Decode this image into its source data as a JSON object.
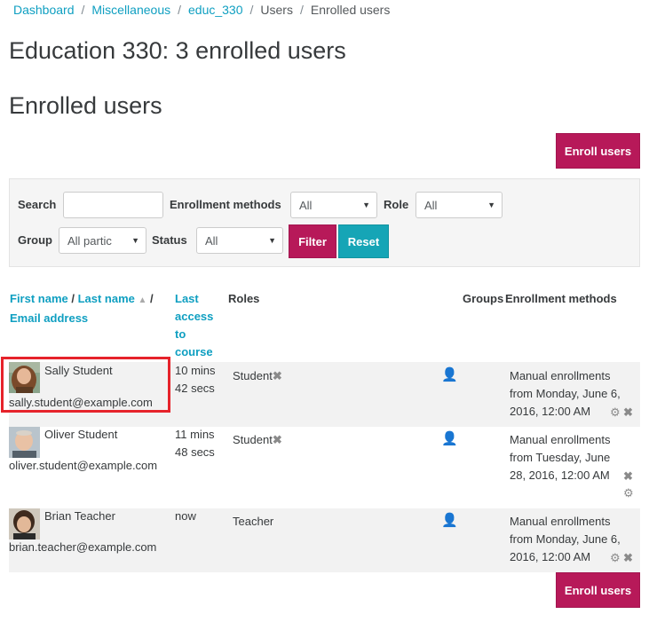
{
  "breadcrumb": {
    "items": [
      "Dashboard",
      "Miscellaneous",
      "educ_330",
      "Users",
      "Enrolled users"
    ],
    "separator": "/"
  },
  "page_title": "Education 330: 3 enrolled users",
  "section_title": "Enrolled users",
  "enroll_button_label": "Enroll users",
  "filters": {
    "search_label": "Search",
    "search_value": "",
    "enrollment_methods_label": "Enrollment methods",
    "enrollment_methods_value": "All",
    "role_label": "Role",
    "role_value": "All",
    "group_label": "Group",
    "group_value": "All partic",
    "status_label": "Status",
    "status_value": "All",
    "filter_button": "Filter",
    "reset_button": "Reset"
  },
  "table": {
    "headers": {
      "first_name": "First name",
      "name_sep": " / ",
      "last_name": "Last name",
      "sort_sep": " /",
      "email": "Email address",
      "last_access": [
        "Last",
        "access",
        "to",
        "course"
      ],
      "roles": "Roles",
      "groups": "Groups",
      "enrollment_methods": "Enrollment methods"
    },
    "rows": [
      {
        "name": "Sally Student",
        "email": "sally.student@example.com",
        "last_access": [
          "10 mins",
          "42 secs"
        ],
        "role": "Student",
        "enrollment": [
          "Manual enrollments",
          "from Monday, June 6,",
          "2016, 12:00 AM"
        ]
      },
      {
        "name": "Oliver Student",
        "email": "oliver.student@example.com",
        "last_access": [
          "11 mins",
          "48 secs"
        ],
        "role": "Student",
        "enrollment": [
          "Manual enrollments",
          "from Tuesday, June",
          "28, 2016, 12:00 AM"
        ]
      },
      {
        "name": "Brian Teacher",
        "email": "brian.teacher@example.com",
        "last_access": [
          "now"
        ],
        "role": "Teacher",
        "enrollment": [
          "Manual enrollments",
          "from Monday, June 6,",
          "2016, 12:00 AM"
        ]
      }
    ]
  },
  "colors": {
    "link": "#0f9fc1",
    "primary_button": "#b71959",
    "reset_button": "#16a5b6",
    "highlight": "#e6232b"
  }
}
